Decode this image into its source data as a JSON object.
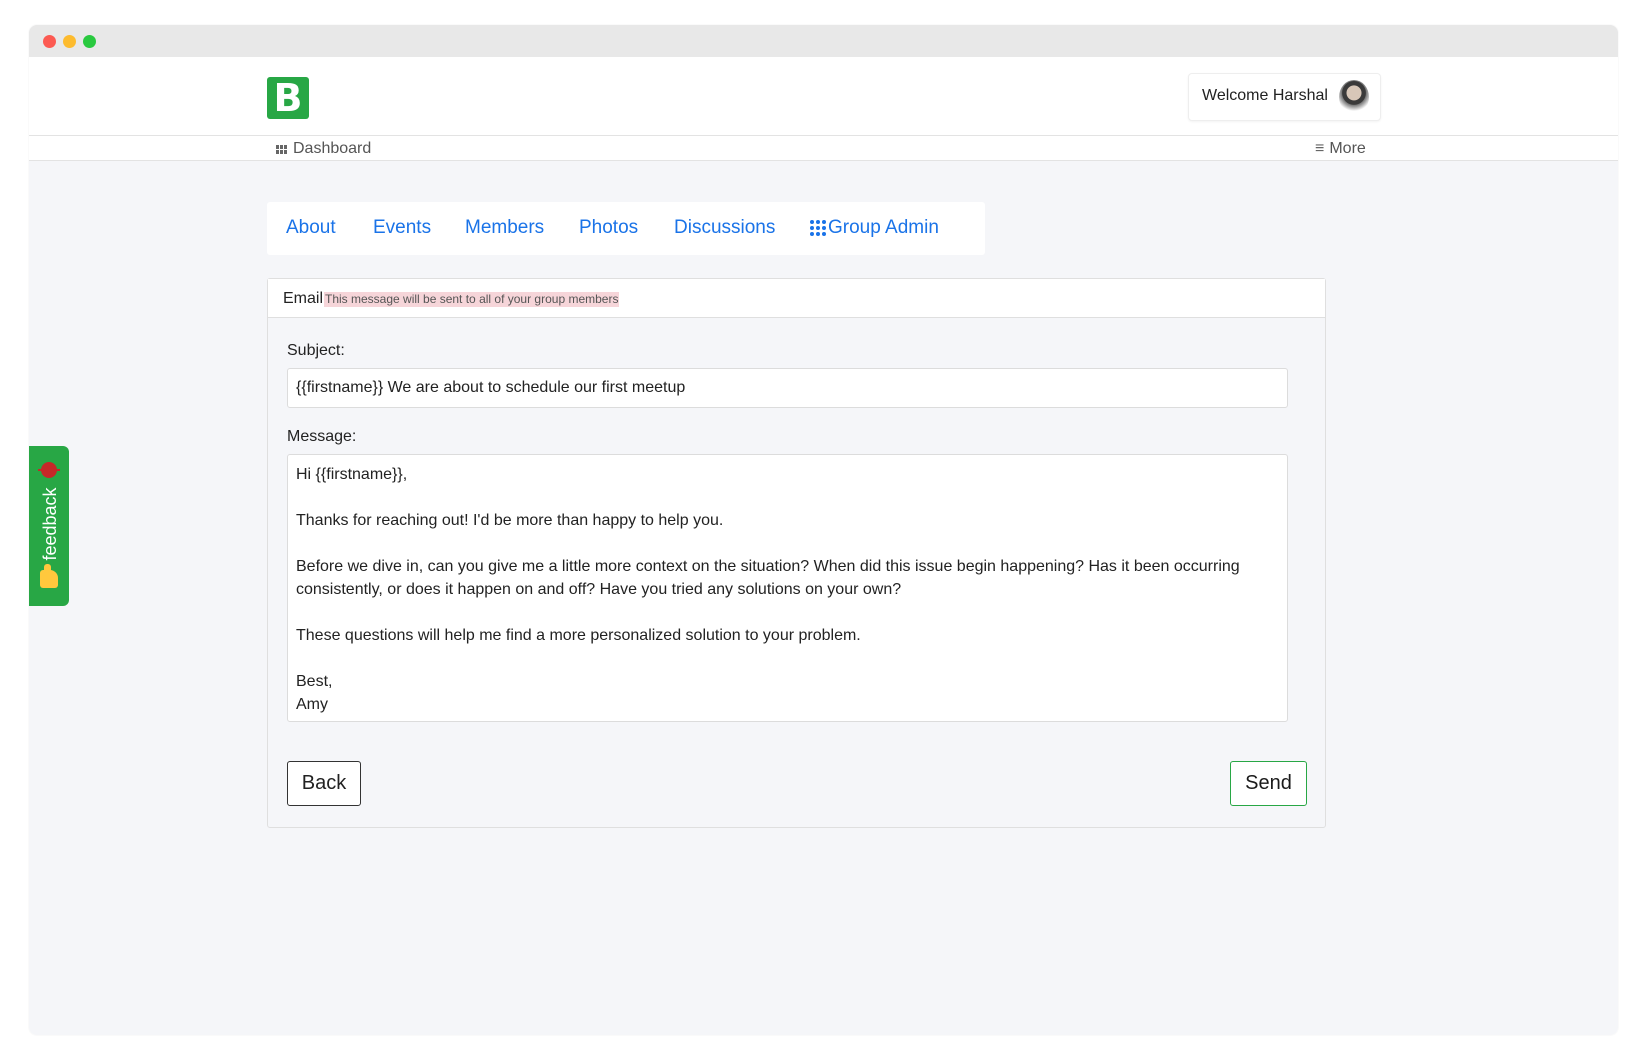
{
  "header": {
    "logo_letter": "B",
    "welcome_text": "Welcome Harshal"
  },
  "nav": {
    "dashboard_label": "Dashboard",
    "more_label": "More"
  },
  "tabs": [
    {
      "label": "About"
    },
    {
      "label": "Events"
    },
    {
      "label": "Members"
    },
    {
      "label": "Photos"
    },
    {
      "label": "Discussions"
    },
    {
      "label": "Group Admin"
    }
  ],
  "email_card": {
    "title": "Email",
    "note": "This message will be sent to all of your group members",
    "subject_label": "Subject:",
    "subject_value": "{{firstname}} We are about to schedule our first meetup",
    "message_label": "Message:",
    "message_value": "Hi {{firstname}},\n\nThanks for reaching out! I'd be more than happy to help you.\n\nBefore we dive in, can you give me a little more context on the situation? When did this issue begin happening? Has it been occurring\nconsistently, or does it happen on and off? Have you tried any solutions on your own?\n\nThese questions will help me find a more personalized solution to your problem.\n\nBest,\nAmy",
    "back_label": "Back",
    "send_label": "Send"
  },
  "feedback": {
    "label": "feedback"
  },
  "colors": {
    "brand_green": "#28a745",
    "link_blue": "#1a73e8",
    "note_highlight": "#f6d5d9"
  },
  "icons": {
    "dashboard": "dashboard-grid-icon",
    "more": "hamburger-menu-icon",
    "group_admin": "apps-grid-icon",
    "feedback_top": "bug-icon",
    "feedback_bottom": "thumbs-up-icon"
  }
}
